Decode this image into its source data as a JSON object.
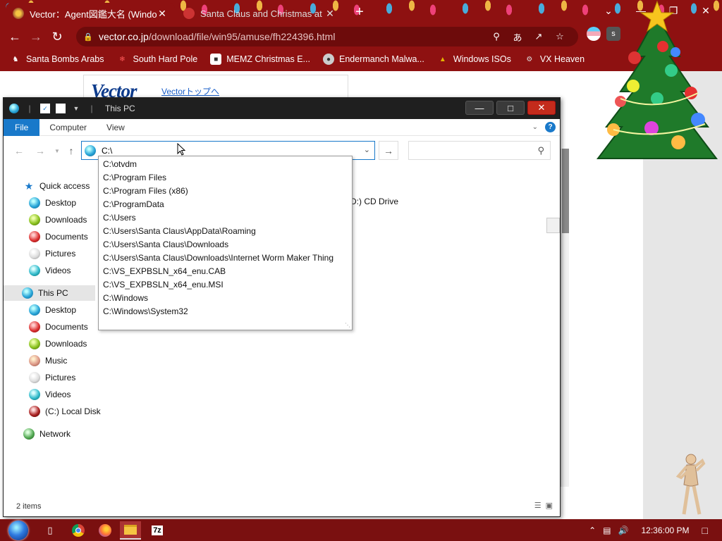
{
  "browser": {
    "tabs": [
      {
        "title": "Vector：Agent図鑑大名 (Window",
        "close": "✕"
      },
      {
        "title": "Santa Claus and Christmas at the",
        "close": "✕"
      }
    ],
    "new_tab": "+",
    "window_controls": {
      "minimize": "⌄",
      "restore": "—",
      "maximize": "❐",
      "close": "✕"
    },
    "url_host": "vector.co.jp",
    "url_path": "/download/file/win95/amuse/fh224396.html",
    "bookmarks": [
      {
        "label": "Santa Bombs Arabs",
        "icon": "santa-icon"
      },
      {
        "label": "South Hard Pole",
        "icon": "snowflake-icon"
      },
      {
        "label": "MEMZ Christmas E...",
        "icon": "memz-icon"
      },
      {
        "label": "Endermanch Malwa...",
        "icon": "raccoon-icon"
      },
      {
        "label": "Windows ISOs",
        "icon": "gnome-icon"
      },
      {
        "label": "VX Heaven",
        "icon": "vx-icon"
      }
    ]
  },
  "webpage": {
    "logo": "Vector",
    "top_link": "Vectorトップへ"
  },
  "explorer": {
    "title": "This PC",
    "ribbon_tabs": [
      "File",
      "Computer",
      "View"
    ],
    "address_value": "C:\\",
    "nav": {
      "quick_access": "Quick access",
      "qa_items": [
        "Desktop",
        "Downloads",
        "Documents",
        "Pictures",
        "Videos"
      ],
      "this_pc": "This PC",
      "pc_items": [
        "Desktop",
        "Documents",
        "Downloads",
        "Music",
        "Pictures",
        "Videos",
        "(C:) Local Disk"
      ],
      "network": "Network"
    },
    "content_partial": "D:) CD Drive",
    "status": "2 items",
    "autocomplete": [
      "C:\\otvdm",
      "C:\\Program Files",
      "C:\\Program Files (x86)",
      "C:\\ProgramData",
      "C:\\Users",
      "C:\\Users\\Santa Claus\\AppData\\Roaming",
      "C:\\Users\\Santa Claus\\Downloads",
      "C:\\Users\\Santa Claus\\Downloads\\Internet Worm Maker Thing",
      "C:\\VS_EXPBSLN_x64_enu.CAB",
      "C:\\VS_EXPBSLN_x64_enu.MSI",
      "C:\\Windows",
      "C:\\Windows\\System32"
    ]
  },
  "taskbar": {
    "clock": "12:36:00 PM",
    "pinned": [
      "task-view-icon",
      "chrome-icon",
      "firefox-icon",
      "file-explorer-icon",
      "7zip-icon"
    ],
    "seven_zip_label": "7z"
  },
  "colors": {
    "chrome_frame": "#8e1111",
    "taskbar": "#7a1010",
    "explorer_accent": "#1979ca",
    "close_red": "#c42b1c"
  }
}
